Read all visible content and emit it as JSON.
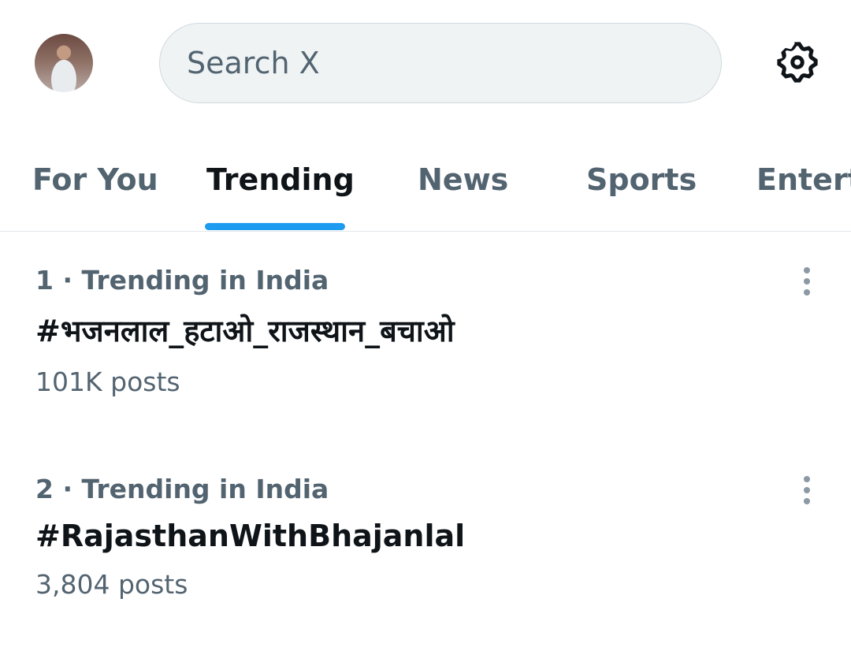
{
  "search": {
    "placeholder": "Search X"
  },
  "header": {
    "settings_icon": "gear-icon",
    "avatar": "user-avatar"
  },
  "tabs": [
    {
      "label": "For You",
      "active": false
    },
    {
      "label": "Trending",
      "active": true
    },
    {
      "label": "News",
      "active": false
    },
    {
      "label": "Sports",
      "active": false
    },
    {
      "label": "Entert",
      "active": false
    }
  ],
  "accent_color": "#1d9bf0",
  "trends": [
    {
      "meta": "1 · Trending in India",
      "title": "#भजनलाल_हटाओ_राजस्थान_बचाओ",
      "count": "101K posts"
    },
    {
      "meta": "2 · Trending in India",
      "title": "#RajasthanWithBhajanlal",
      "count": "3,804 posts"
    }
  ]
}
